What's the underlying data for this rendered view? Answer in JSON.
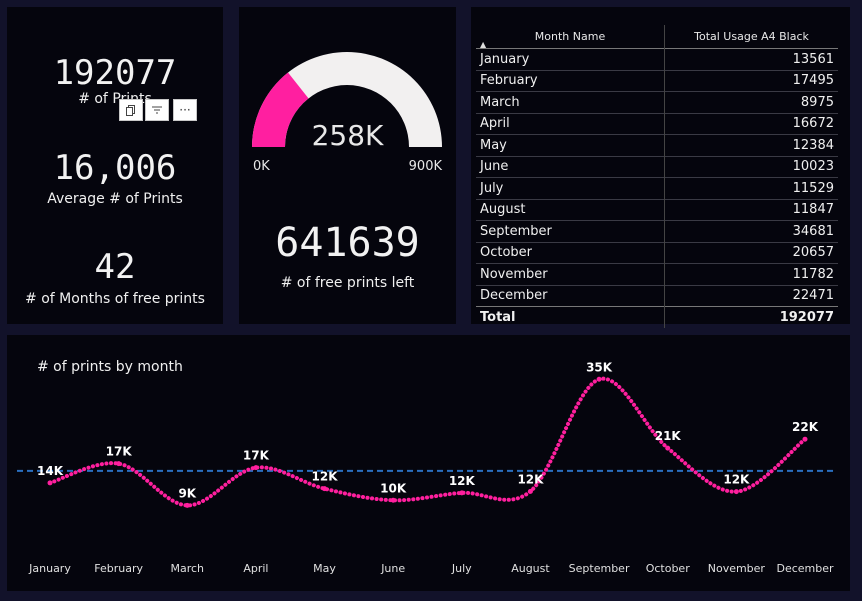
{
  "kpis": {
    "total_prints": {
      "value": "192077",
      "label": "# of Prints"
    },
    "average_prints": {
      "value": "16,006",
      "label": "Average # of Prints"
    },
    "months_free": {
      "value": "42",
      "label": "# of Months of free prints"
    }
  },
  "visual_toolbar": {
    "copy_icon": "copy-icon",
    "filter_icon": "filter-icon",
    "more_label": "···"
  },
  "gauge": {
    "center_label": "258K",
    "min_label": "0K",
    "max_label": "900K",
    "value": 258,
    "max": 900,
    "fill_color": "#ff1fa0",
    "track_color": "#f2f0f0"
  },
  "free_prints": {
    "value": "641639",
    "label": "# of free prints left"
  },
  "table": {
    "headers": [
      "Month Name",
      "Total Usage A4 Black"
    ],
    "rows": [
      [
        "January",
        "13561"
      ],
      [
        "February",
        "17495"
      ],
      [
        "March",
        "8975"
      ],
      [
        "April",
        "16672"
      ],
      [
        "May",
        "12384"
      ],
      [
        "June",
        "10023"
      ],
      [
        "July",
        "11529"
      ],
      [
        "August",
        "11847"
      ],
      [
        "September",
        "34681"
      ],
      [
        "October",
        "20657"
      ],
      [
        "November",
        "11782"
      ],
      [
        "December",
        "22471"
      ]
    ],
    "total": [
      "Total",
      "192077"
    ]
  },
  "chart": {
    "title": "# of prints by month"
  },
  "chart_data": {
    "type": "line",
    "categories": [
      "January",
      "February",
      "March",
      "April",
      "May",
      "June",
      "July",
      "August",
      "September",
      "October",
      "November",
      "December"
    ],
    "series": [
      {
        "values": [
          13561,
          17495,
          8975,
          16672,
          12384,
          10023,
          11529,
          11847,
          34681,
          20657,
          11782,
          22471
        ]
      }
    ],
    "data_labels": [
      "14K",
      "17K",
      "9K",
      "17K",
      "12K",
      "10K",
      "12K",
      "12K",
      "35K",
      "21K",
      "12K",
      "22K"
    ],
    "reference_line": 16006,
    "line_color": "#ff1f9e",
    "reference_color": "#2a6fc0",
    "ylim": [
      6000,
      38000
    ],
    "grid": false
  }
}
